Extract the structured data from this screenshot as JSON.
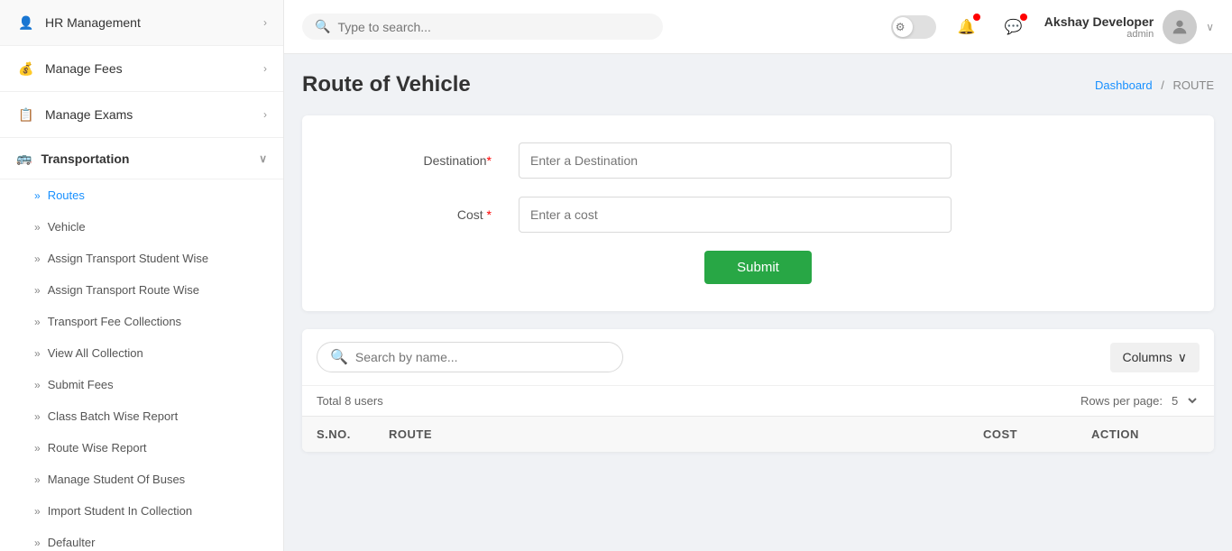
{
  "sidebar": {
    "items": [
      {
        "id": "hr-management",
        "label": "HR Management",
        "icon": "👤",
        "hasArrow": true
      },
      {
        "id": "manage-fees",
        "label": "Manage Fees",
        "icon": "💰",
        "hasArrow": true
      },
      {
        "id": "manage-exams",
        "label": "Manage Exams",
        "icon": "📋",
        "hasArrow": true
      },
      {
        "id": "transportation",
        "label": "Transportation",
        "icon": "🚌",
        "hasArrow": true,
        "expanded": true
      }
    ],
    "subItems": [
      {
        "id": "routes",
        "label": "Routes",
        "active": true
      },
      {
        "id": "vehicle",
        "label": "Vehicle",
        "active": false
      },
      {
        "id": "assign-transport-student",
        "label": "Assign Transport Student Wise",
        "active": false
      },
      {
        "id": "assign-transport-route",
        "label": "Assign Transport Route Wise",
        "active": false
      },
      {
        "id": "transport-fee-collections",
        "label": "Transport Fee Collections",
        "active": false
      },
      {
        "id": "view-all-collection",
        "label": "View All Collection",
        "active": false
      },
      {
        "id": "submit-fees",
        "label": "Submit Fees",
        "active": false
      },
      {
        "id": "class-batch-wise-report",
        "label": "Class Batch Wise Report",
        "active": false
      },
      {
        "id": "route-wise-report",
        "label": "Route Wise Report",
        "active": false
      },
      {
        "id": "manage-student-of-buses",
        "label": "Manage Student Of Buses",
        "active": false
      },
      {
        "id": "import-student-in-collection",
        "label": "Import Student In Collection",
        "active": false
      },
      {
        "id": "defaulter",
        "label": "Defaulter",
        "active": false
      }
    ]
  },
  "header": {
    "search_placeholder": "Type to search...",
    "user": {
      "name": "Akshay Developer",
      "role": "admin"
    }
  },
  "page": {
    "title": "Route of Vehicle",
    "breadcrumb_home": "Dashboard",
    "breadcrumb_current": "ROUTE"
  },
  "form": {
    "destination_label": "Destination",
    "destination_placeholder": "Enter a Destination",
    "cost_label": "Cost",
    "cost_placeholder": "Enter a cost",
    "submit_label": "Submit"
  },
  "table": {
    "search_placeholder": "Search by name...",
    "columns_label": "Columns",
    "total_users": "Total 8 users",
    "rows_per_page_label": "Rows per page:",
    "rows_per_page_value": "5",
    "columns": [
      {
        "id": "sno",
        "label": "S.NO."
      },
      {
        "id": "route",
        "label": "ROUTE"
      },
      {
        "id": "cost",
        "label": "COST"
      },
      {
        "id": "action",
        "label": "ACTION"
      }
    ]
  }
}
